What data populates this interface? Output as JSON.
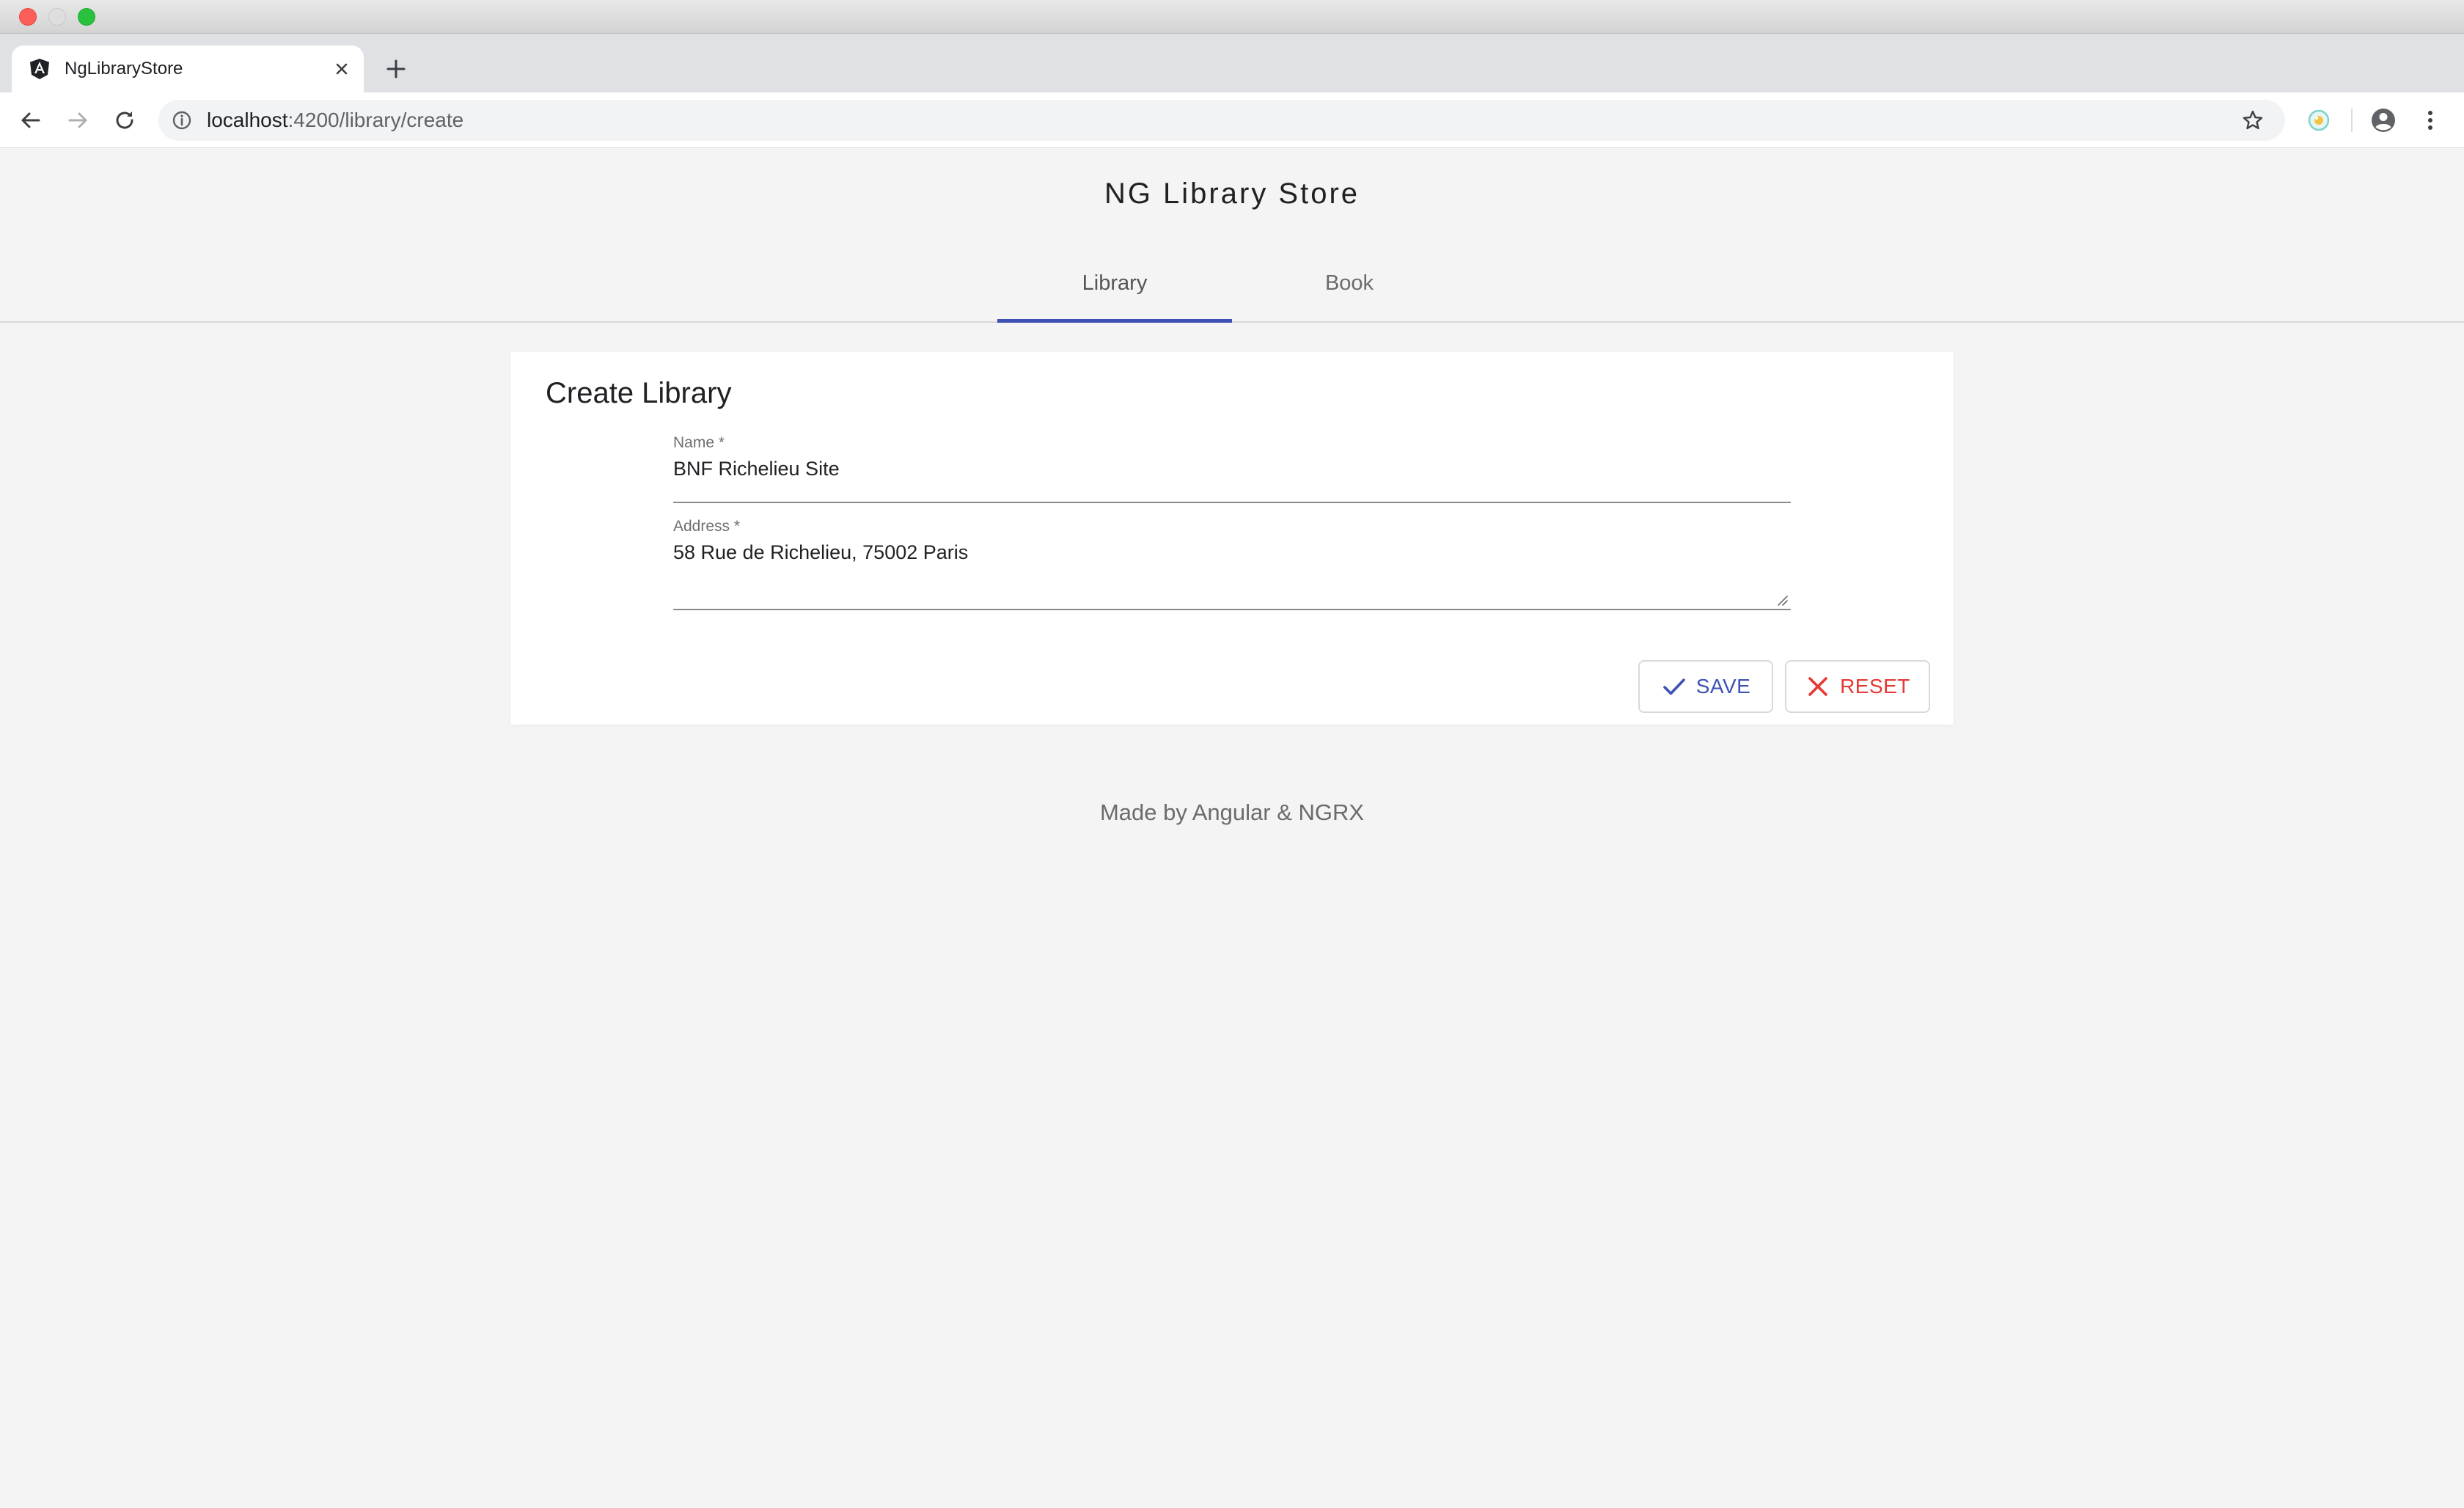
{
  "browser": {
    "tab": {
      "title": "NgLibraryStore",
      "favicon": "angular-icon"
    },
    "url": {
      "host": "localhost",
      "path": ":4200/library/create"
    }
  },
  "app": {
    "title": "NG Library Store",
    "nav": {
      "tabs": [
        {
          "label": "Library",
          "active": true
        },
        {
          "label": "Book",
          "active": false
        }
      ]
    },
    "form": {
      "title": "Create Library",
      "fields": {
        "name": {
          "label": "Name *",
          "value": "BNF Richelieu Site"
        },
        "address": {
          "label": "Address *",
          "value": "58 Rue de Richelieu, 75002 Paris"
        }
      },
      "actions": {
        "save_label": "SAVE",
        "reset_label": "RESET"
      }
    },
    "footer": "Made by Angular & NGRX"
  },
  "colors": {
    "primary": "#3f51b5",
    "warn": "#e53935",
    "background": "#f4f4f4"
  }
}
